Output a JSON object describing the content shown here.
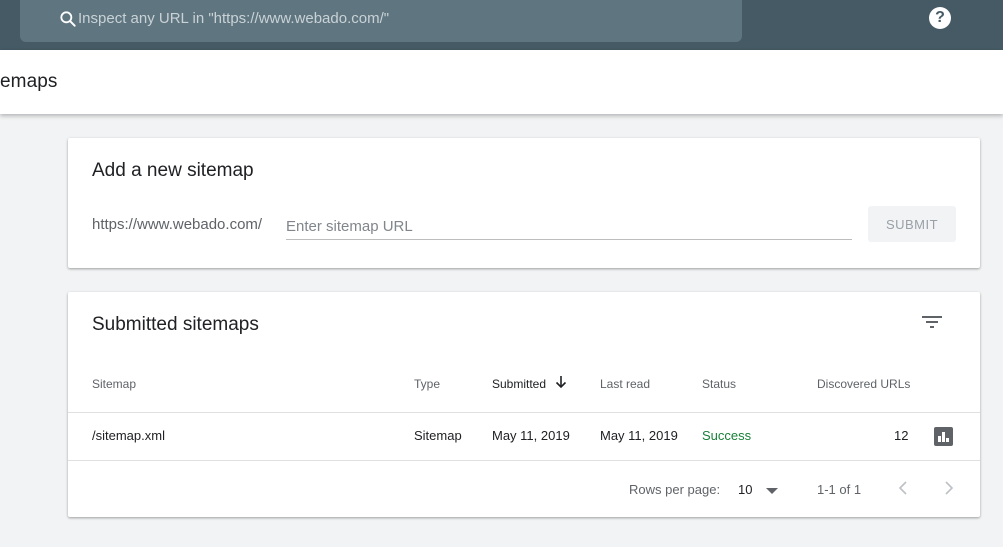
{
  "topbar": {
    "search_placeholder": "Inspect any URL in \"https://www.webado.com/\"",
    "help_label": "?"
  },
  "page": {
    "title": "emaps"
  },
  "add_sitemap": {
    "title": "Add a new sitemap",
    "url_prefix": "https://www.webado.com/",
    "input_placeholder": "Enter sitemap URL",
    "submit_label": "SUBMIT"
  },
  "submitted": {
    "title": "Submitted sitemaps",
    "columns": [
      "Sitemap",
      "Type",
      "Submitted",
      "Last read",
      "Status",
      "Discovered URLs"
    ],
    "rows": [
      {
        "sitemap": "/sitemap.xml",
        "type": "Sitemap",
        "submitted": "May 11, 2019",
        "last_read": "May 11, 2019",
        "status": "Success",
        "discovered_urls": "12"
      }
    ],
    "footer": {
      "rows_per_page_label": "Rows per page:",
      "rows_per_page_value": "10",
      "range": "1-1 of 1"
    }
  },
  "colors": {
    "topbar": "#455a64",
    "status_success": "#188038"
  }
}
